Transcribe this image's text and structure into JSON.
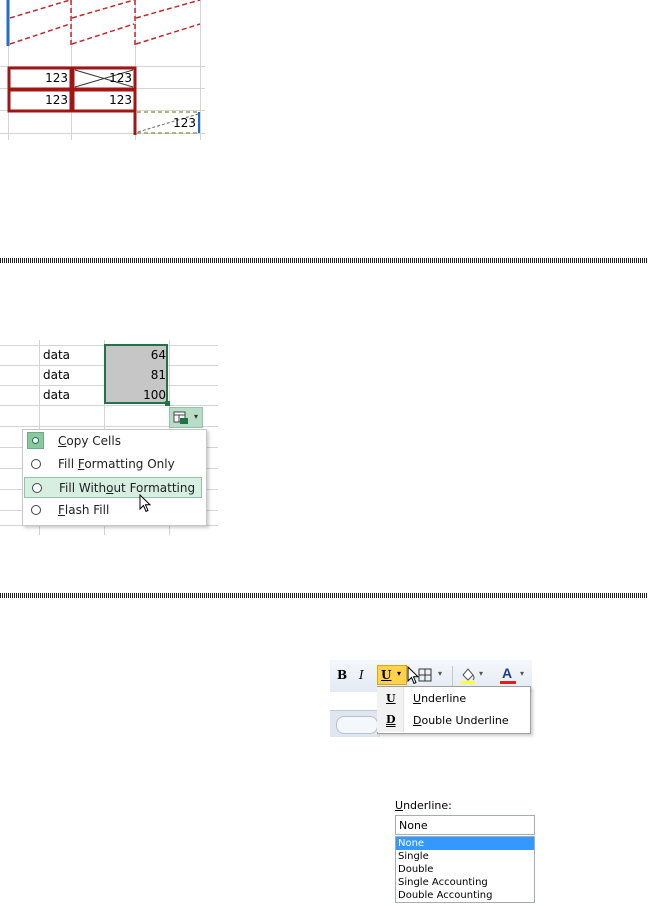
{
  "panel1": {
    "cells": {
      "r1c1": "123",
      "r1c2": "123",
      "r2c1": "123",
      "r2c2": "123",
      "r3c3": "123"
    },
    "colors": {
      "border_red": "#a31515",
      "dash_red": "#c0282d",
      "blue": "#1f6fc5",
      "olive": "#9aa05a"
    }
  },
  "panel2": {
    "rows": [
      {
        "label": "data",
        "value": "64"
      },
      {
        "label": "data",
        "value": "81"
      },
      {
        "label": "data",
        "value": "100"
      }
    ],
    "autofill_icon": "autofill-options-icon",
    "menu": [
      {
        "pre": "",
        "key": "C",
        "post": "opy Cells",
        "selected": true
      },
      {
        "pre": "Fill ",
        "key": "F",
        "post": "ormatting Only",
        "selected": false
      },
      {
        "pre": "Fill With",
        "key": "o",
        "post": "ut Formatting",
        "selected": false,
        "hover": true
      },
      {
        "pre": "",
        "key": "F",
        "post": "lash Fill",
        "selected": false
      }
    ],
    "colors": {
      "accent": "#217346",
      "hover_bg": "#d6efe0",
      "select_bg": "#c6c6c6"
    }
  },
  "panel3": {
    "toolbar": {
      "bold": "B",
      "italic": "I",
      "underline": "U",
      "font_color_letter": "A"
    },
    "underline_menu": [
      {
        "icon": "U",
        "key": "U",
        "rest": "nderline"
      },
      {
        "icon": "D",
        "key": "D",
        "rest": "ouble Underline"
      }
    ],
    "dialog": {
      "label_key": "U",
      "label_rest": "nderline:",
      "selected_value": "None",
      "options": [
        "None",
        "Single",
        "Double",
        "Single Accounting",
        "Double Accounting"
      ]
    },
    "colors": {
      "highlight": "#ffd24d",
      "list_select": "#3399ff",
      "font_red": "#e0201b"
    }
  }
}
